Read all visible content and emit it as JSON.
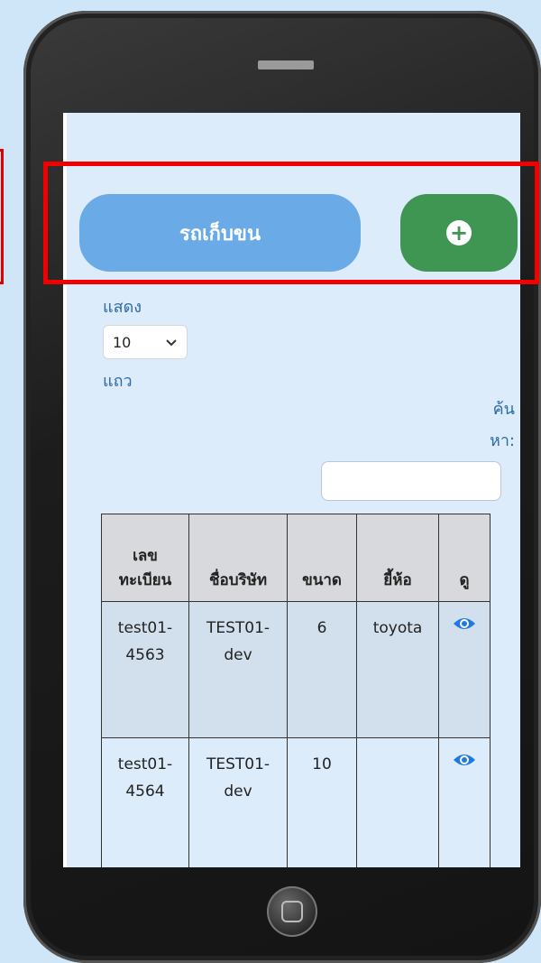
{
  "header": {
    "title_button": "รถเก็บขน"
  },
  "length_menu": {
    "show_label": "แสดง",
    "selected_value": "10",
    "rows_label": "แถว"
  },
  "search": {
    "label_line1": "ค้น",
    "label_line2": "หา:",
    "value": ""
  },
  "table": {
    "headers": [
      "เลข\nทะเบียน",
      "ชื่อบริษัท",
      "ขนาด",
      "ยี้ห้อ",
      "ดู"
    ],
    "rows": [
      {
        "plate": "test01-4563",
        "company": "TEST01-dev",
        "size": "6",
        "brand": "toyota"
      },
      {
        "plate": "test01-4564",
        "company": "TEST01-dev",
        "size": "10",
        "brand": ""
      }
    ]
  },
  "icons": {
    "add": "plus-circle-icon",
    "view": "eye-icon",
    "select": "chevron-down-icon"
  },
  "colors": {
    "primary_blue": "#6aaae6",
    "success_green": "#3f9652",
    "highlight_red": "#f20000"
  }
}
